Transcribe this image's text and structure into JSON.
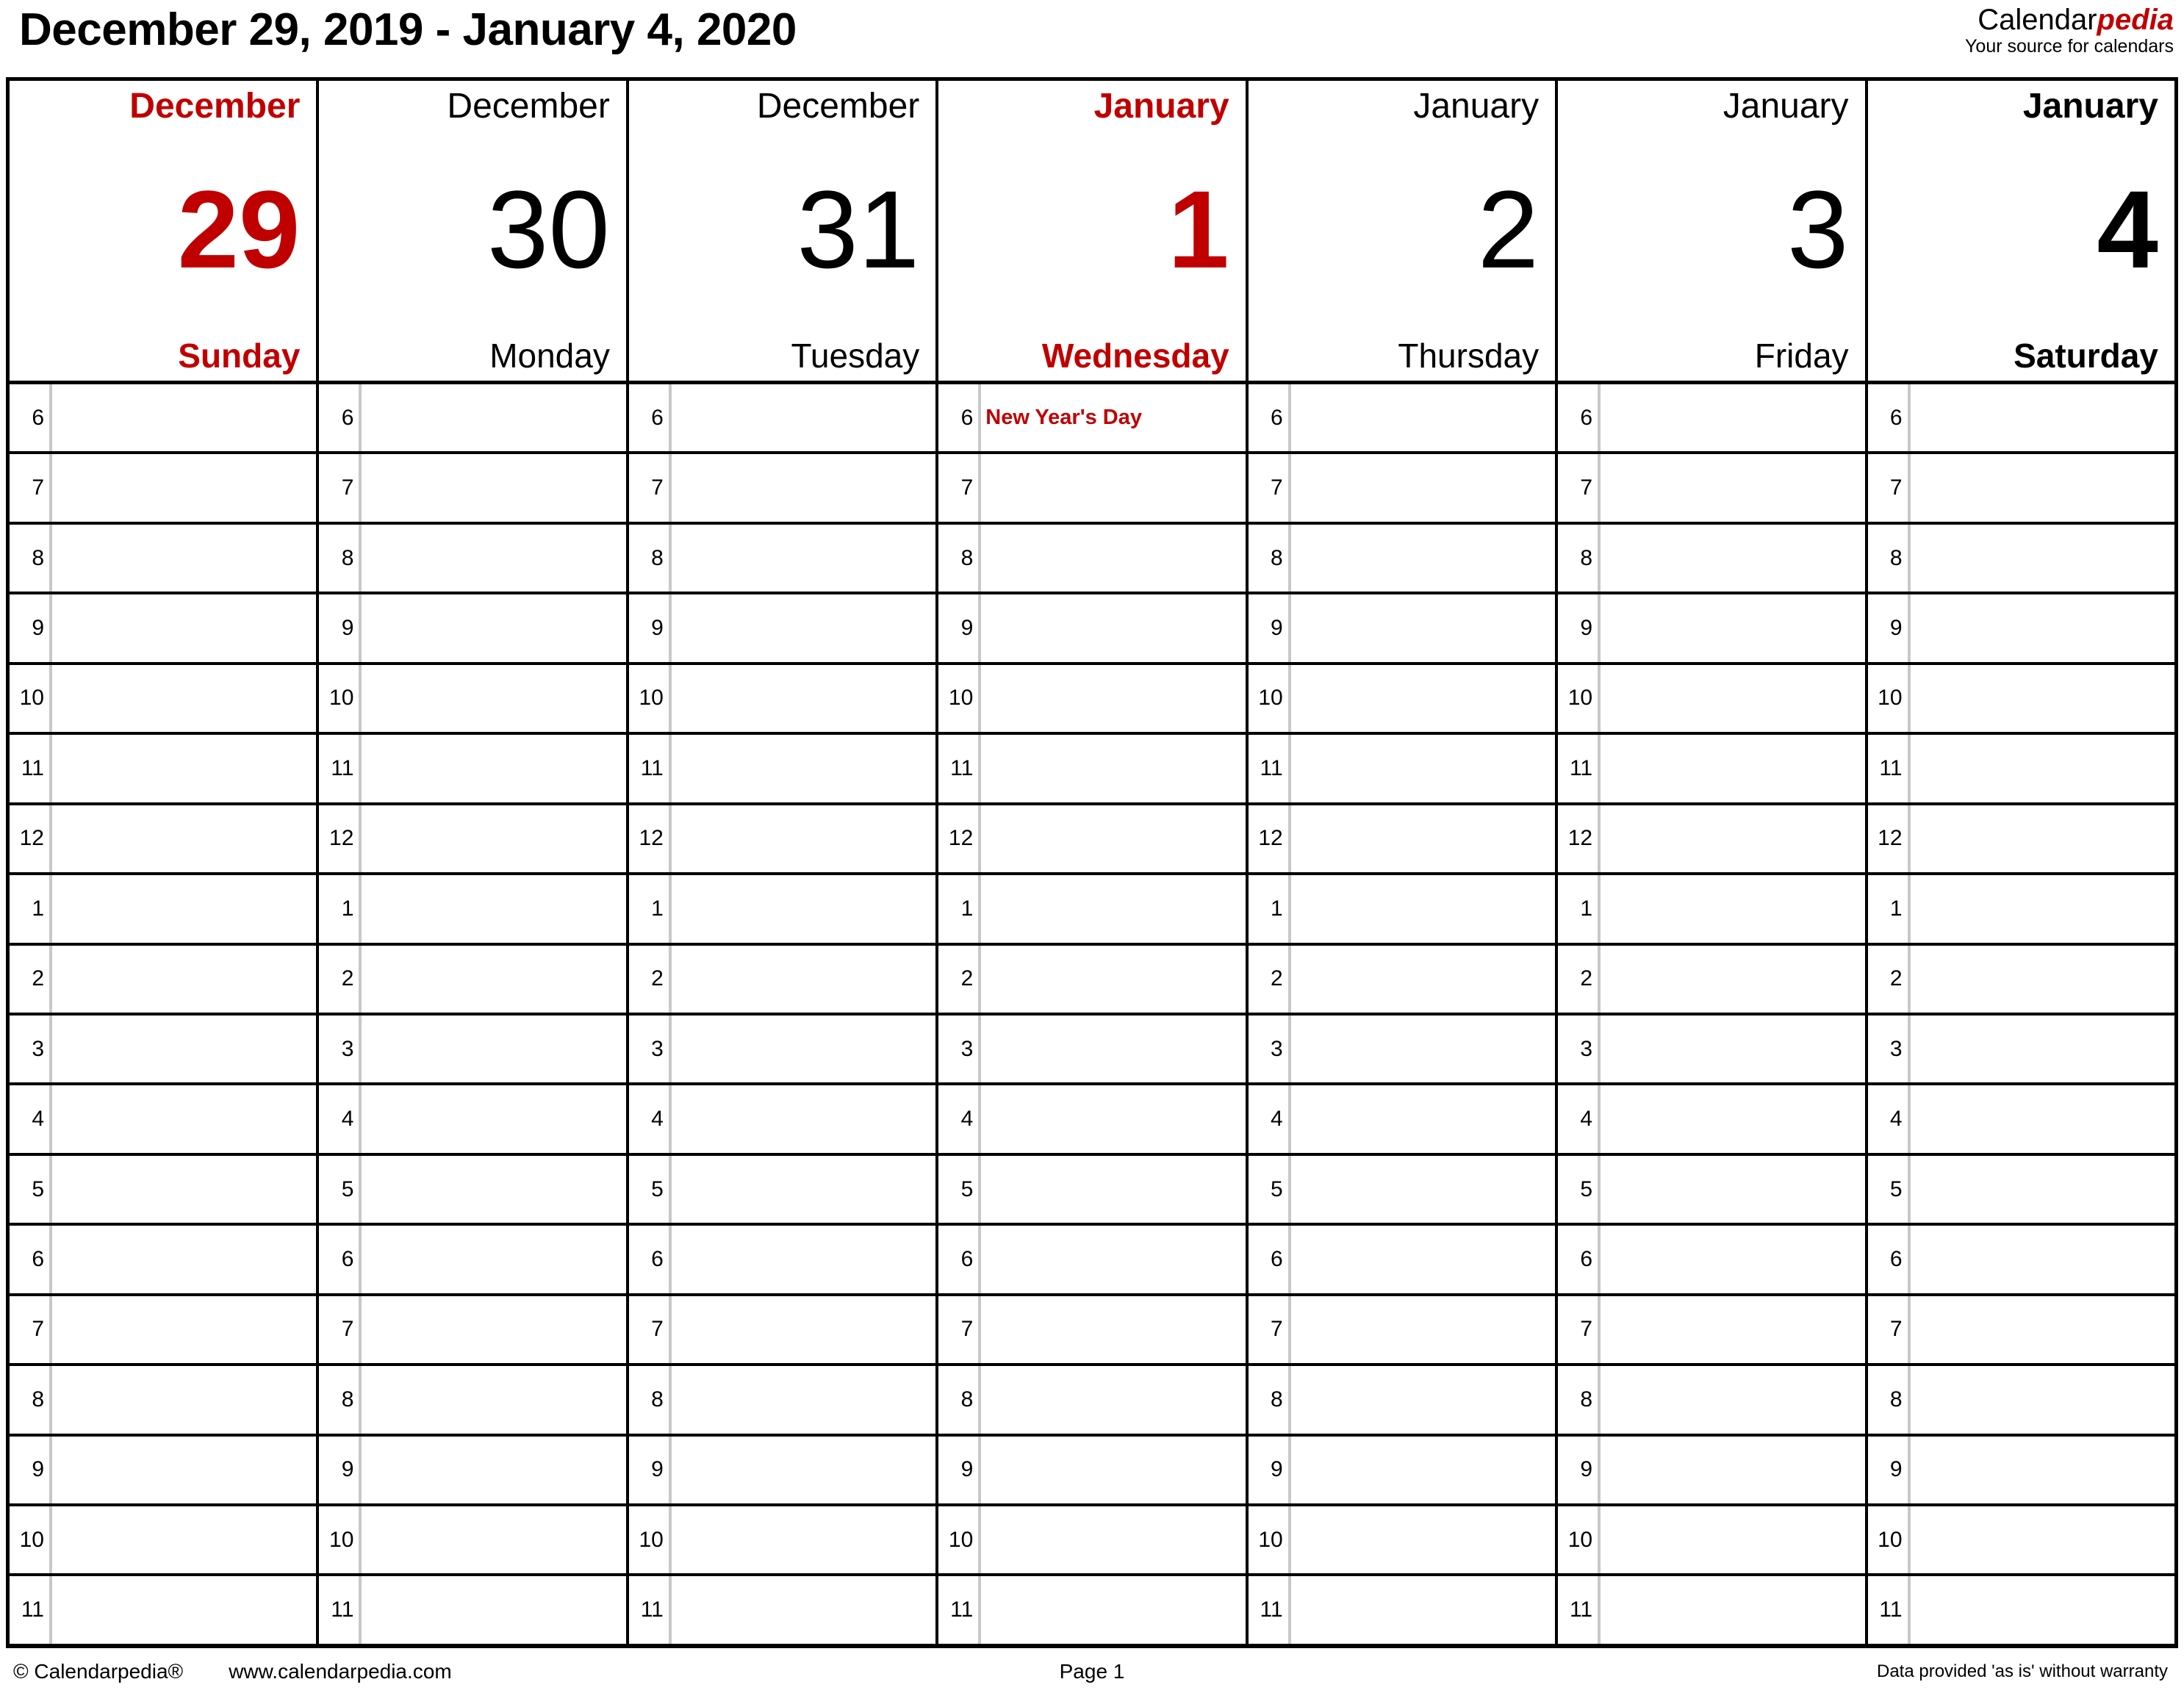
{
  "header": {
    "range_title": "December 29, 2019 - January 4, 2020",
    "brand_part1": "Calendar",
    "brand_part2": "pedia",
    "brand_tagline": "Your source for calendars"
  },
  "colors": {
    "accent_red": "#C00000",
    "text_black": "#000000",
    "grid_line": "#000000",
    "gutter_line": "#C8C8C8",
    "background": "#FFFFFF"
  },
  "days": [
    {
      "month": "December",
      "number": "29",
      "dayname": "Sunday",
      "style": "accent",
      "event": ""
    },
    {
      "month": "December",
      "number": "30",
      "dayname": "Monday",
      "style": "weekday",
      "event": ""
    },
    {
      "month": "December",
      "number": "31",
      "dayname": "Tuesday",
      "style": "weekday",
      "event": ""
    },
    {
      "month": "January",
      "number": "1",
      "dayname": "Wednesday",
      "style": "accent",
      "event": "New Year's Day"
    },
    {
      "month": "January",
      "number": "2",
      "dayname": "Thursday",
      "style": "weekday",
      "event": ""
    },
    {
      "month": "January",
      "number": "3",
      "dayname": "Friday",
      "style": "weekday",
      "event": ""
    },
    {
      "month": "January",
      "number": "4",
      "dayname": "Saturday",
      "style": "bold-day",
      "event": ""
    }
  ],
  "hours": [
    "6",
    "7",
    "8",
    "9",
    "10",
    "11",
    "12",
    "1",
    "2",
    "3",
    "4",
    "5",
    "6",
    "7",
    "8",
    "9",
    "10",
    "11"
  ],
  "footer": {
    "copyright": "© Calendarpedia®",
    "website": "www.calendarpedia.com",
    "page": "Page 1",
    "disclaimer": "Data provided 'as is' without warranty"
  }
}
